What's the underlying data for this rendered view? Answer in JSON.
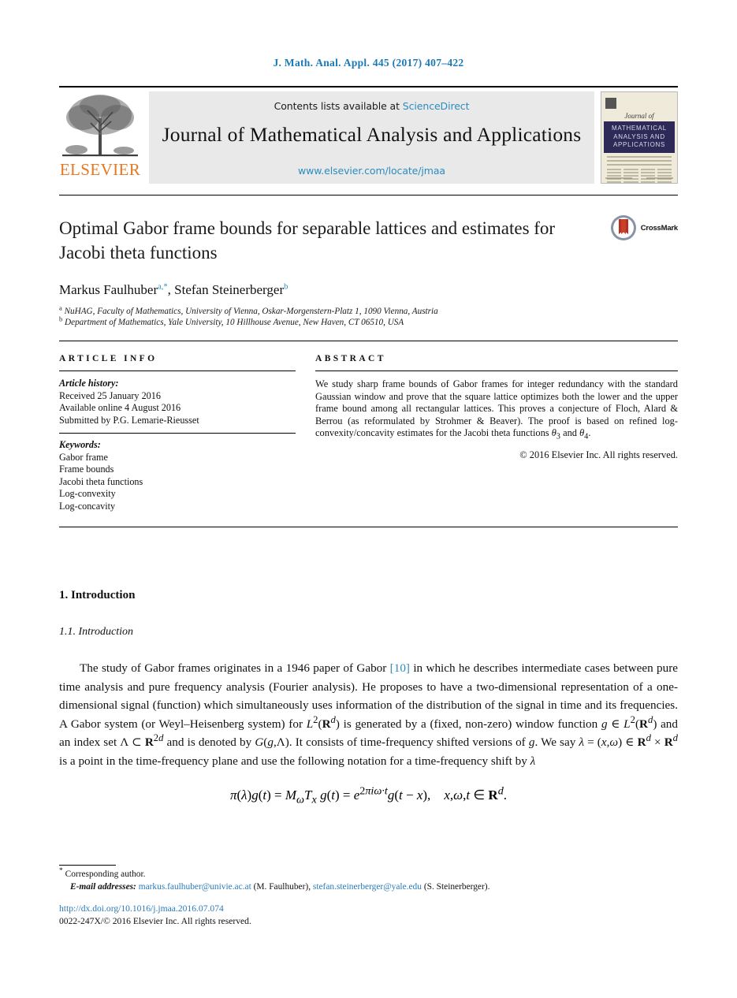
{
  "running_head": "J. Math. Anal. Appl. 445 (2017) 407–422",
  "masthead": {
    "contents_prefix": "Contents lists available at",
    "sciencedirect": "ScienceDirect",
    "journal_title": "Journal of Mathematical Analysis and Applications",
    "journal_url": "www.elsevier.com/locate/jmaa",
    "publisher_wordmark": "ELSEVIER",
    "cover": {
      "script_line": "Journal of",
      "band_line_1": "MATHEMATICAL",
      "band_line_2": "ANALYSIS AND",
      "band_line_3": "APPLICATIONS"
    }
  },
  "article": {
    "title": "Optimal Gabor frame bounds for separable lattices and estimates for Jacobi theta functions",
    "crossmark_label": "CrossMark",
    "authors": "Markus Faulhuber",
    "author_1_marks": "a,*",
    "author_2": ", Stefan Steinerberger",
    "author_2_marks": "b",
    "affiliation_a_mark": "a",
    "affiliation_a": "NuHAG, Faculty of Mathematics, University of Vienna, Oskar-Morgenstern-Platz 1, 1090 Vienna, Austria",
    "affiliation_b_mark": "b",
    "affiliation_b": "Department of Mathematics, Yale University, 10 Hillhouse Avenue, New Haven, CT 06510, USA"
  },
  "info": {
    "heading": "ARTICLE INFO",
    "history_label": "Article history:",
    "history": [
      "Received 25 January 2016",
      "Available online 4 August 2016",
      "Submitted by P.G. Lemarie-Rieusset"
    ],
    "keywords_label": "Keywords:",
    "keywords": [
      "Gabor frame",
      "Frame bounds",
      "Jacobi theta functions",
      "Log-convexity",
      "Log-concavity"
    ]
  },
  "abstract": {
    "heading": "ABSTRACT",
    "text": "We study sharp frame bounds of Gabor frames for integer redundancy with the standard Gaussian window and prove that the square lattice optimizes both the lower and the upper frame bound among all rectangular lattices. This proves a conjecture of Floch, Alard & Berrou (as reformulated by Strohmer & Beaver). The proof is based on refined log-convexity/concavity estimates for the Jacobi theta functions θ3 and θ4.",
    "copyright": "© 2016 Elsevier Inc. All rights reserved."
  },
  "body": {
    "section_1": "1. Introduction",
    "subsection_1_1": "1.1. Introduction",
    "paragraph_part_1": "The study of Gabor frames originates in a 1946 paper of Gabor ",
    "citation_10": "[10]",
    "paragraph_part_2": " in which he describes intermediate cases between pure time analysis and pure frequency analysis (Fourier analysis). He proposes to have a two-dimensional representation of a one-dimensional signal (function) which simultaneously uses information of the distribution of the signal in time and its frequencies. A Gabor system (or Weyl–Heisenberg system) for L2(Rd) is generated by a (fixed, non-zero) window function g ∈ L2(Rd) and an index set Λ ⊂ R2d and is denoted by G(g, Λ). It consists of time-frequency shifted versions of g. We say λ = (x,ω) ∈ Rd × Rd is a point in the time-frequency plane and use the following notation for a time-frequency shift by λ",
    "equation": "π(λ)g(t) = MωTx g(t) = e2πiω·t g(t − x),    x,ω,t ∈ Rd."
  },
  "footer": {
    "corresponding_marker": "*",
    "corresponding_author": "Corresponding author.",
    "email_label": "E-mail addresses:",
    "email_1": "markus.faulhuber@univie.ac.at",
    "email_1_owner": "(M. Faulhuber),",
    "email_2": "stefan.steinerberger@yale.edu",
    "email_2_owner": "(S. Steinerberger).",
    "doi": "http://dx.doi.org/10.1016/j.jmaa.2016.07.074",
    "issn_line": "0022-247X/© 2016 Elsevier Inc. All rights reserved."
  },
  "colors": {
    "link_blue": "#2b8cbe",
    "running_head_blue": "#1b7ab5",
    "elsevier_orange": "#e87722",
    "cover_band_navy": "#2e2a58",
    "masthead_gray": "#e9e9e9"
  }
}
